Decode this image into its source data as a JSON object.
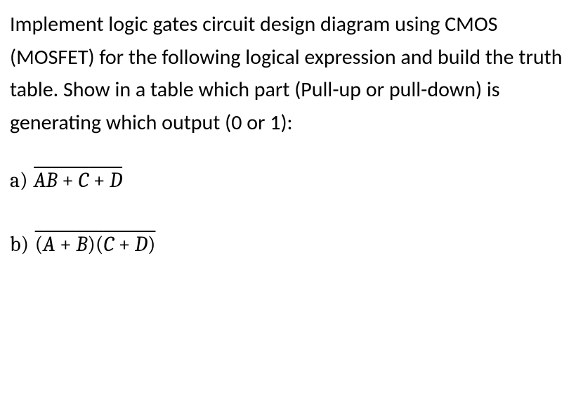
{
  "problem": {
    "text": "Implement logic gates circuit design diagram using CMOS (MOSFET) for the following logical expression and build the truth table. Show in a table which part (Pull-up or pull-down) is generating which output (0 or 1):"
  },
  "parts": {
    "a": {
      "label": "a) ",
      "expression_text": "AB + C + D",
      "var1": "AB",
      "op1": " + ",
      "var2": "C",
      "op2": " + ",
      "var3": "D"
    },
    "b": {
      "label": "b) ",
      "expression_text": "(A + B)(C + D)",
      "paren1": "(",
      "var1": "A",
      "op1": " + ",
      "var2": "B",
      "paren2": ")(",
      "var3": "C",
      "op2": " + ",
      "var4": "D",
      "paren3": ")"
    }
  }
}
